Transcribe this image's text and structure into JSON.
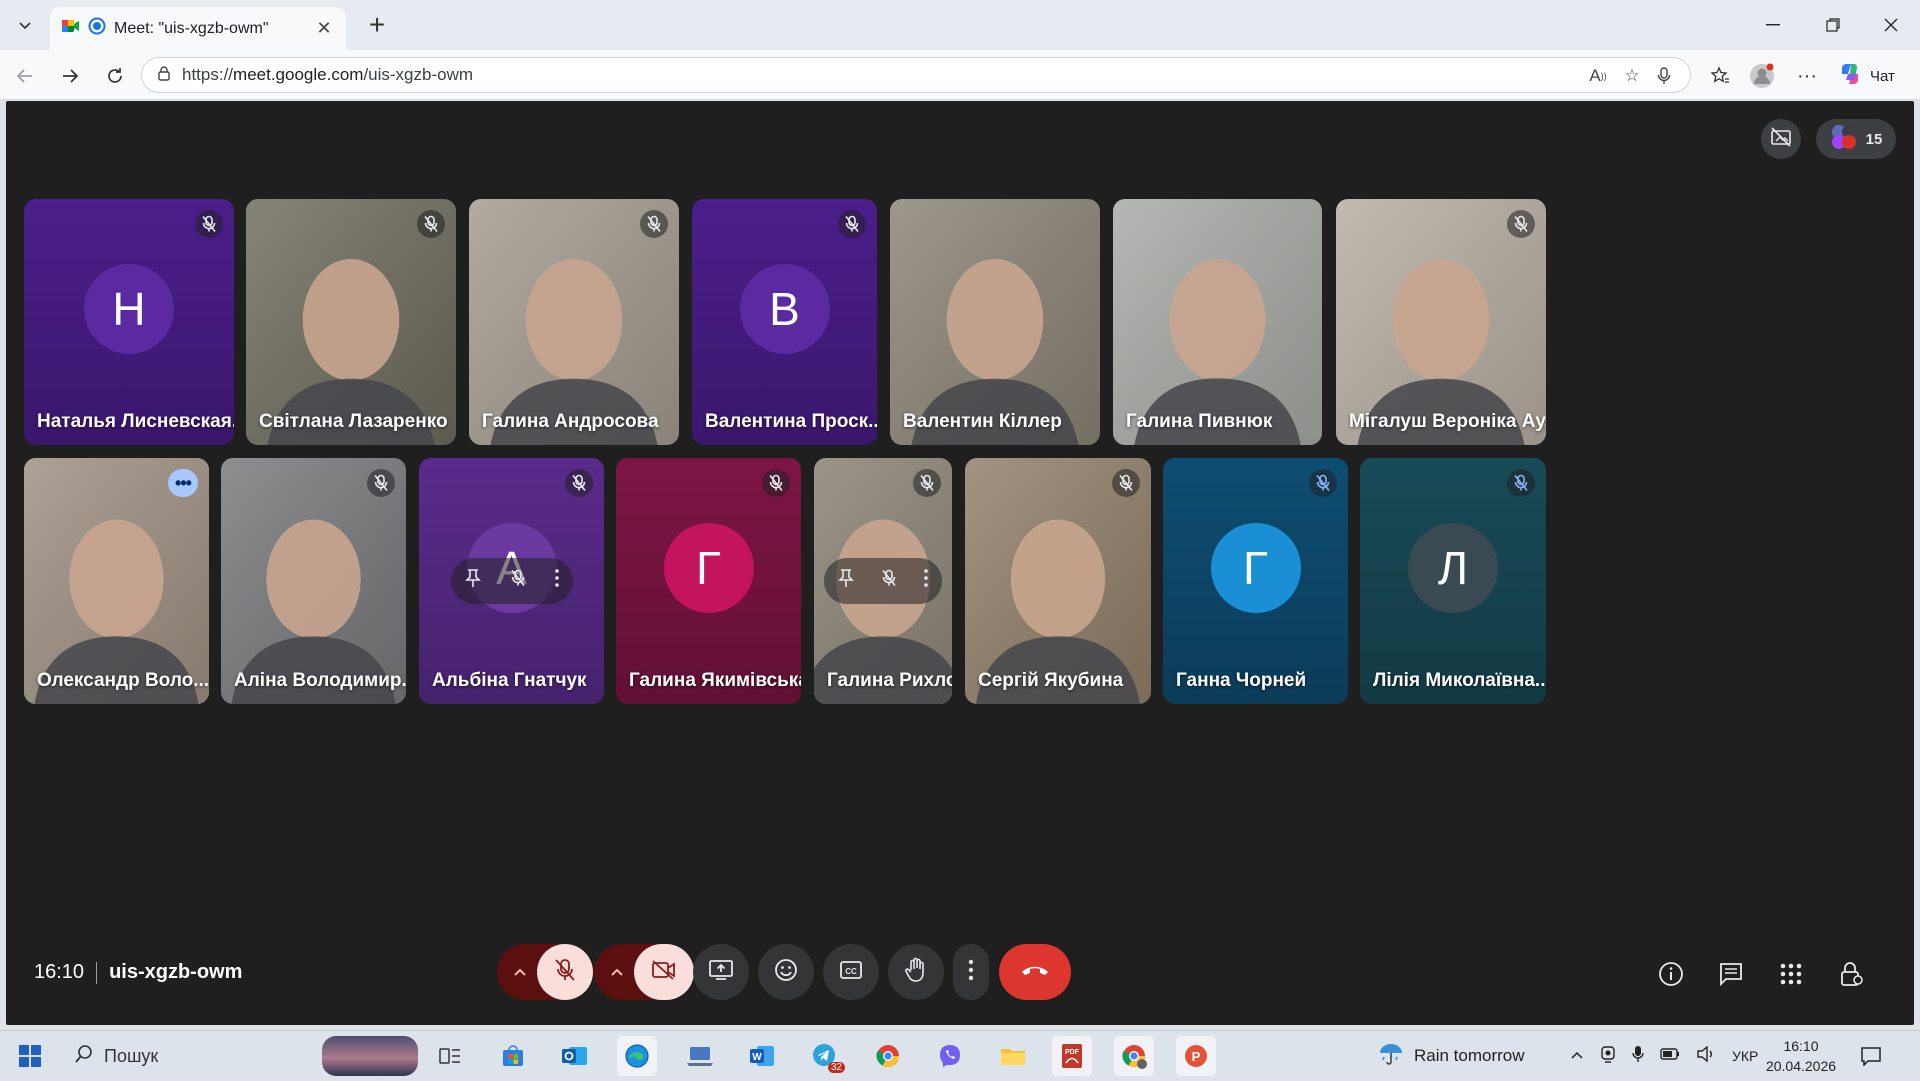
{
  "browser": {
    "tab_title": "Meet: \"uis-xgzb-owm\"",
    "url_prefix": "https://",
    "url_domain": "meet.google.com",
    "url_path": "/uis-xgzb-owm",
    "chat_label": "Чат"
  },
  "meet": {
    "participant_count": "15",
    "time": "16:10",
    "meeting_code": "uis-xgzb-owm",
    "row1": [
      {
        "name": "Наталья Лисневская...",
        "initial": "Н",
        "kind": "avatar",
        "bg": "#4b1e8a"
      },
      {
        "name": "Світлана Лазаренко",
        "kind": "video",
        "bg": "#6c6b5c"
      },
      {
        "name": "Галина Андросова",
        "kind": "video",
        "bg": "#a39a8e"
      },
      {
        "name": "Валентина Проск...",
        "initial": "В",
        "kind": "avatar",
        "bg": "#4b1e8a"
      },
      {
        "name": "Валентин Кіллер",
        "kind": "video",
        "bg": "#8a8275"
      },
      {
        "name": "Галина Пивнюк",
        "kind": "video",
        "bg": "#a5a9a3"
      },
      {
        "name": "Мігалуш Вероніка Ау...",
        "kind": "video",
        "bg": "#b6ada1"
      }
    ],
    "row2": [
      {
        "name": "Олександр Воло...",
        "kind": "video",
        "bg": "#9e8f82"
      },
      {
        "name": "Аліна Володимир...",
        "kind": "video",
        "bg": "#77787a"
      },
      {
        "name": "Альбіна Гнатчук",
        "initial": "А",
        "kind": "avatar",
        "bg": "#5a2b8c"
      },
      {
        "name": "Галина Якимівська",
        "initial": "Г",
        "kind": "avatar",
        "bg": "#7d1544"
      },
      {
        "name": "Галина Рихло",
        "kind": "video",
        "bg": "#8b8375"
      },
      {
        "name": "Сергій Якубина",
        "kind": "video",
        "bg": "#8f7f67"
      },
      {
        "name": "Ганна Чорней",
        "initial": "Г",
        "kind": "avatar",
        "bg": "#0e4d72"
      },
      {
        "name": "Лілія Миколаївна...",
        "initial": "Л",
        "kind": "avatar",
        "bg": "#184a57"
      }
    ]
  },
  "taskbar": {
    "search_placeholder": "Пошук",
    "weather": "Rain tomorrow",
    "lang": "УКР",
    "clock_time": "16:10",
    "clock_date": "20.04.2026",
    "telegram_badge": "32"
  }
}
